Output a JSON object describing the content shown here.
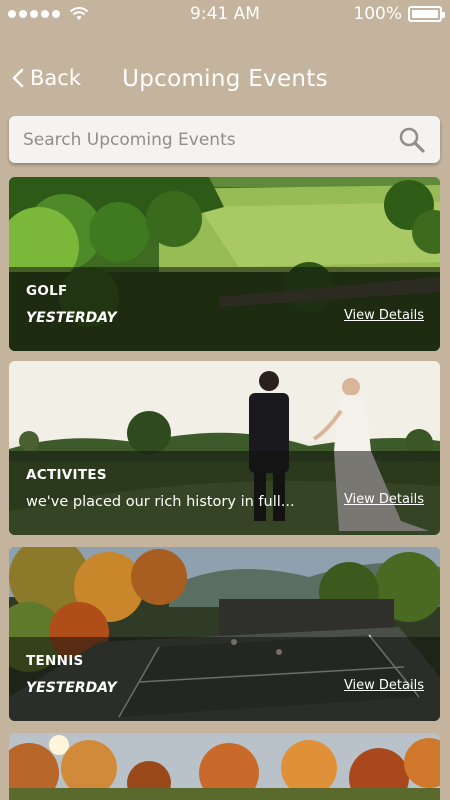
{
  "status_bar": {
    "time": "9:41 AM",
    "battery": "100%"
  },
  "nav": {
    "back_label": "Back",
    "title": "Upcoming Events"
  },
  "search": {
    "placeholder": "Search Upcoming Events"
  },
  "events": [
    {
      "title": "GOLF",
      "subtitle": "YESTERDAY",
      "link": "View Details"
    },
    {
      "title": "ACTIVITES",
      "subtitle": "we've placed our rich history in full...",
      "link": "View Details"
    },
    {
      "title": "TENNIS",
      "subtitle": "YESTERDAY",
      "link": "View Details"
    }
  ],
  "colors": {
    "background": "#c4b49e",
    "search_bg": "#f4f3f1",
    "text": "#ffffff"
  }
}
